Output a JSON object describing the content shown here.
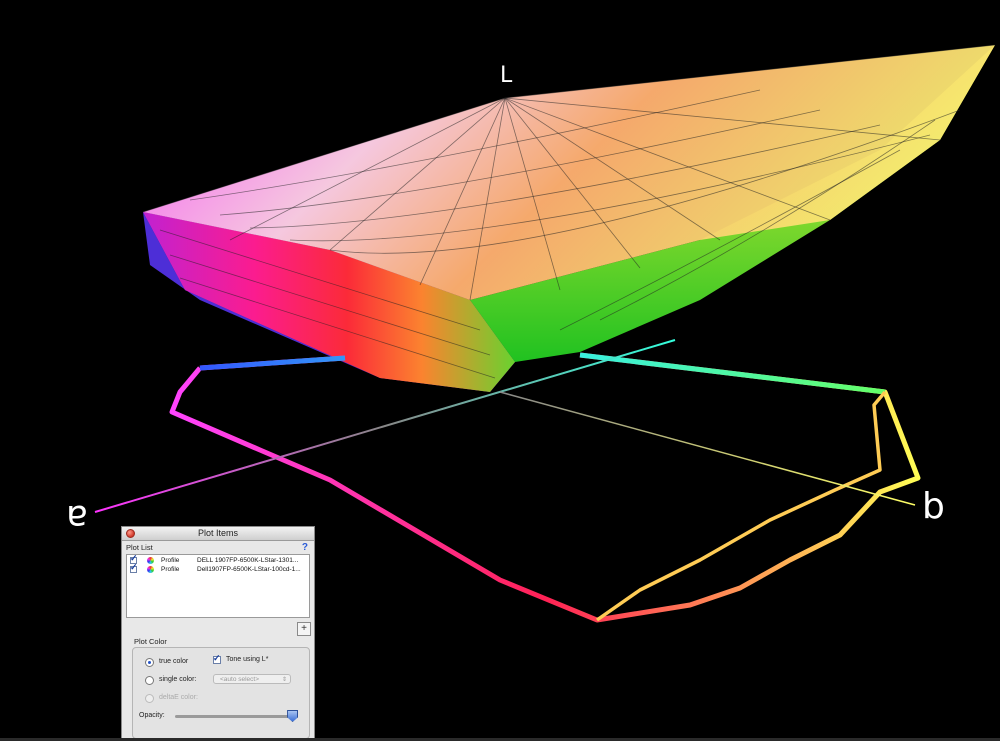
{
  "scene": {
    "axis_labels": {
      "l": "L",
      "a": "a",
      "b": "b"
    },
    "colors": {
      "background": "#000000",
      "a_axis_neg": "#ff33ff",
      "a_axis_pos": "#33ffdd",
      "b_axis": "#ffff66"
    }
  },
  "panel": {
    "title": "Plot Items",
    "plot_list_label": "Plot List",
    "help": "?",
    "rows": [
      {
        "type": "Profile",
        "name": "DELL 1907FP-6500K-LStar-1301...",
        "checked": true
      },
      {
        "type": "Profile",
        "name": "Dell1907FP-6500K-LStar-100cd-1...",
        "checked": true
      }
    ],
    "add_button": "+",
    "plot_color_label": "Plot Color",
    "options": {
      "true_color": "true color",
      "tone": "Tone using L*",
      "single_color": "single color:",
      "auto_select": "<auto select>",
      "delta_e": "deltaE color:"
    },
    "opacity_label": "Opacity:",
    "opacity_value": 0.98
  }
}
